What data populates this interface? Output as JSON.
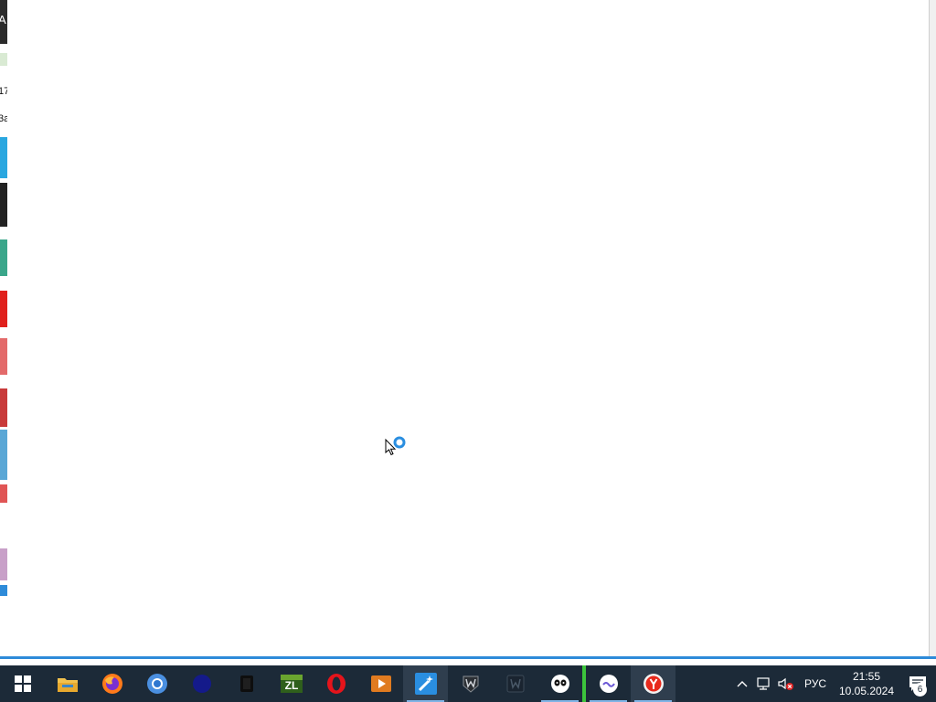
{
  "left_strip": {
    "fragments": [
      "A",
      "17",
      "3a"
    ]
  },
  "taskbar": {
    "apps": [
      {
        "name": "start-button"
      },
      {
        "name": "file-explorer-icon"
      },
      {
        "name": "firefox-icon"
      },
      {
        "name": "chrome-icon"
      },
      {
        "name": "dark-blue-app-icon"
      },
      {
        "name": "dark-app-icon"
      },
      {
        "name": "zl-app-icon",
        "label": "ZL"
      },
      {
        "name": "opera-icon"
      },
      {
        "name": "video-app-icon"
      },
      {
        "name": "magic-wand-app-icon"
      },
      {
        "name": "world-of-tanks-icon"
      },
      {
        "name": "game-launcher-icon"
      },
      {
        "name": "panda-app-icon"
      },
      {
        "name": "chat-app-icon"
      },
      {
        "name": "yandex-browser-icon"
      }
    ],
    "tray": {
      "language": "РУС",
      "time": "21:55",
      "date": "10.05.2024",
      "notification_count": "6"
    }
  },
  "colors": {
    "taskbar_bg": "#1c2a38",
    "accent": "#2e8bd9"
  }
}
